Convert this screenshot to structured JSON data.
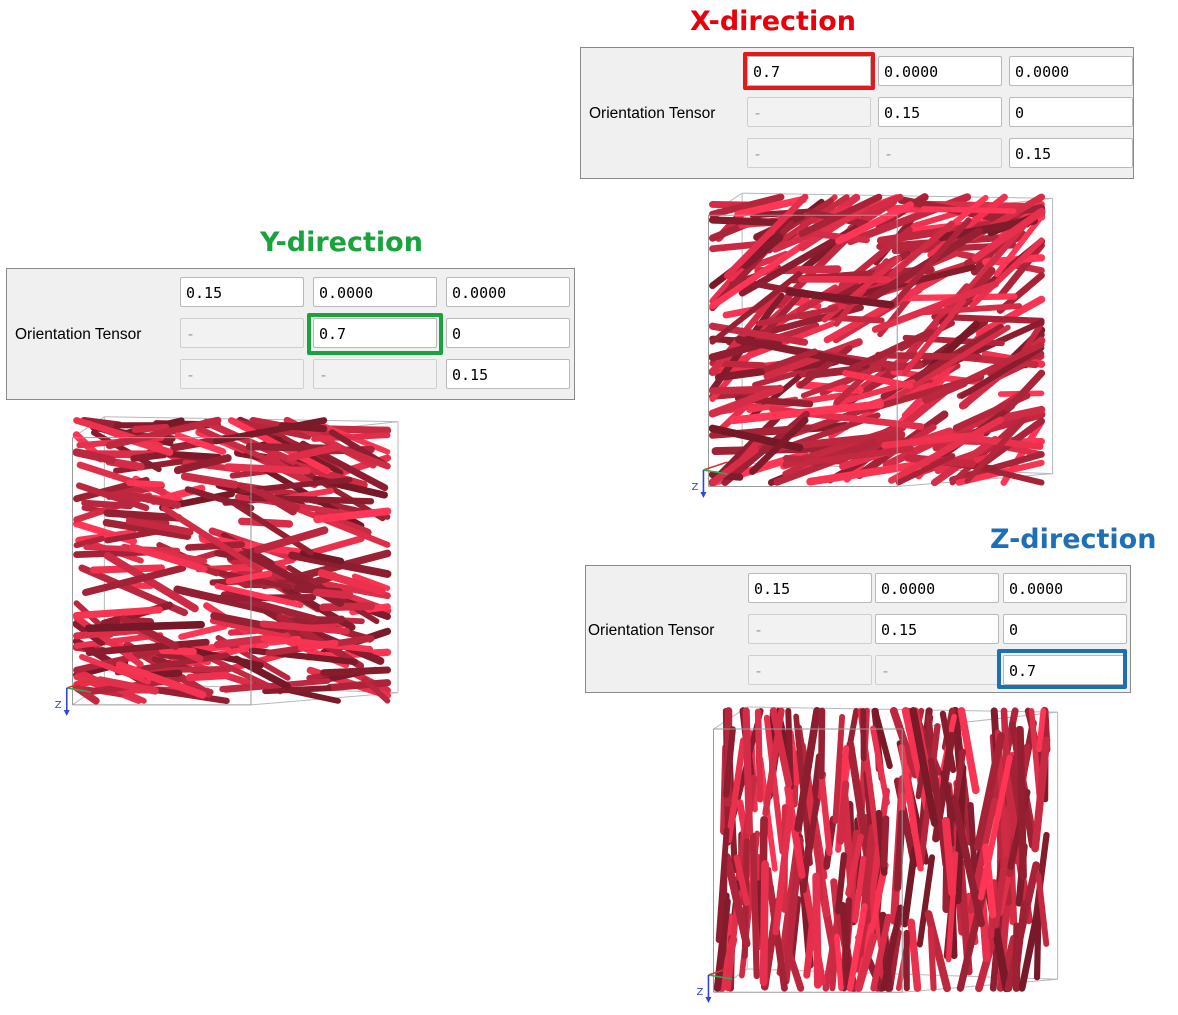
{
  "panels": [
    {
      "title": "X-direction",
      "title_color": "#e8000b",
      "highlight_color": "#e31a1c",
      "label": "Orientation Tensor",
      "cells": [
        "0.7",
        "0.0000",
        "0.0000",
        "-",
        "0.15",
        "0",
        "-",
        "-",
        "0.15"
      ],
      "highlighted_cell": 0
    },
    {
      "title": "Y-direction",
      "title_color": "#1aa33c",
      "highlight_color": "#1aa33c",
      "label": "Orientation Tensor",
      "cells": [
        "0.15",
        "0.0000",
        "0.0000",
        "-",
        "0.7",
        "0",
        "-",
        "-",
        "0.15"
      ],
      "highlighted_cell": 4
    },
    {
      "title": "Z-direction",
      "title_color": "#1f6fb5",
      "highlight_color": "#1f6fb5",
      "label": "Orientation Tensor",
      "cells": [
        "0.15",
        "0.0000",
        "0.0000",
        "-",
        "0.15",
        "0",
        "-",
        "-",
        "0.7"
      ],
      "highlighted_cell": 8
    }
  ],
  "fiber_color": "#d22c46",
  "axes_triad": {
    "x_color": "#e03030",
    "y_color": "#22b14c",
    "z_color": "#3344dd",
    "z_label": "Z"
  }
}
